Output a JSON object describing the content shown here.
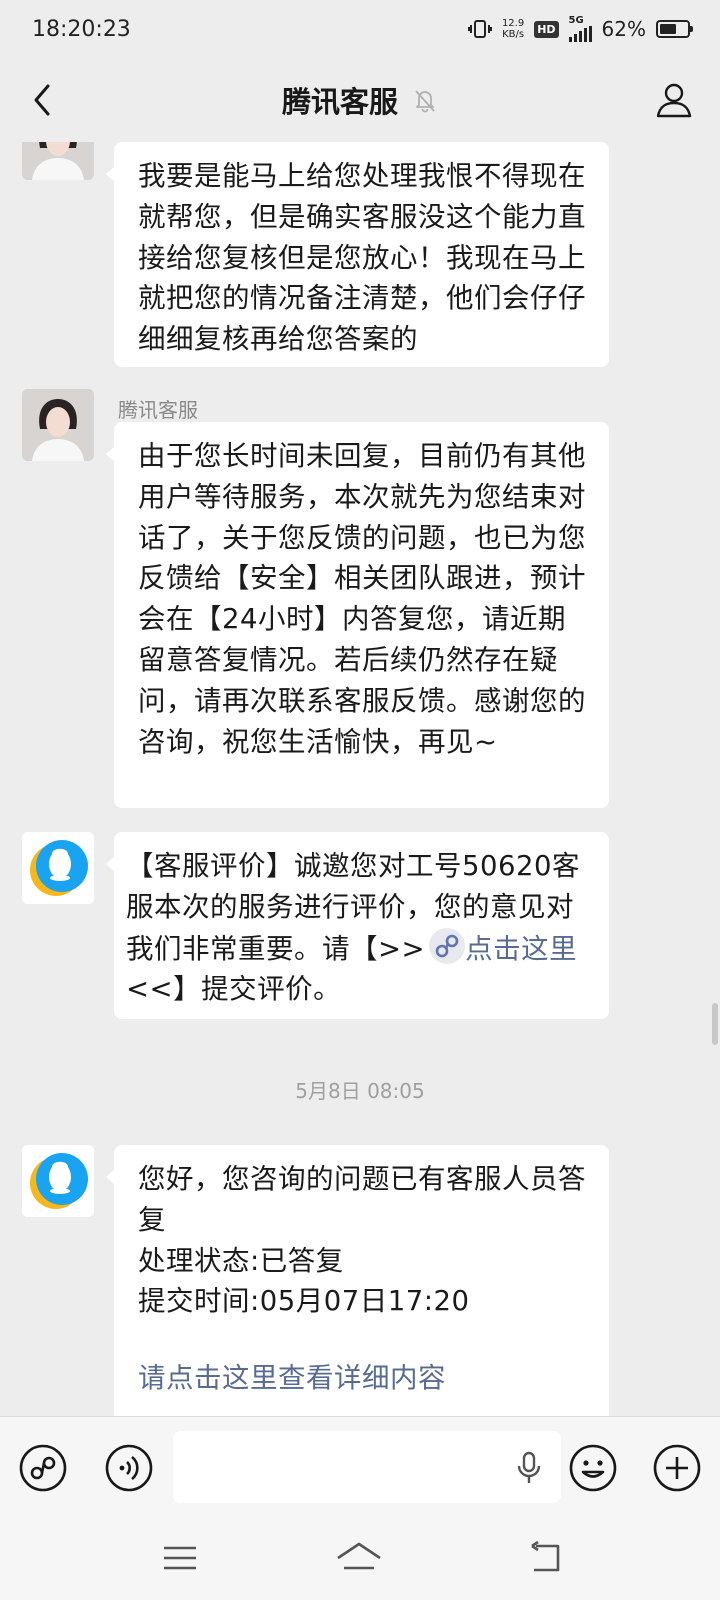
{
  "status_bar": {
    "time": "18:20:23",
    "net_speed_value": "12.9",
    "net_speed_unit": "KB/s",
    "hd_label": "HD",
    "network_type": "5G",
    "battery_percent": "62%",
    "battery_level": 0.62
  },
  "header": {
    "title": "腾讯客服",
    "back_icon": "chevron-left-icon",
    "mute_icon": "bell-off-icon",
    "profile_icon": "person-icon"
  },
  "messages": [
    {
      "sender": "",
      "avatar": "agent-photo",
      "text": "我要是能马上给您处理我恨不得现在就帮您，但是确实客服没这个能力直接给您复核但是您放心！我现在马上就把您的情况备注清楚，他们会仔仔细细复核再给您答案的"
    },
    {
      "sender": "腾讯客服",
      "avatar": "agent-photo",
      "text": "由于您长时间未回复，目前仍有其他用户等待服务，本次就先为您结束对话了，关于您反馈的问题，也已为您反馈给【安全】相关团队跟进，预计会在【24小时】内答复您，请近期留意答复情况。若后续仍然存在疑问，请再次联系客服反馈。感谢您的咨询，祝您生活愉快，再见~"
    },
    {
      "sender": "",
      "avatar": "qq-service-logo",
      "text_before": "【客服评价】诚邀您对工号50620客服本次的服务进行评价，您的意见对我们非常重要。请【>>",
      "link_text": "点击这里",
      "text_after": "<<】提交评价。"
    },
    {
      "timestamp": "5月8日 08:05"
    },
    {
      "sender": "",
      "avatar": "qq-service-logo",
      "lines": [
        "您好，您咨询的问题已有客服人员答复",
        "处理状态:已答复",
        "提交时间:05月07日17:20"
      ],
      "link_text": "请点击这里查看详细内容"
    }
  ],
  "input_bar": {
    "placeholder": "",
    "left_icons": [
      "mini-program-icon",
      "voice-icon"
    ],
    "right_icons": [
      "emoji-icon",
      "plus-icon"
    ],
    "mic_icon": "microphone-icon"
  },
  "nav_bar": {
    "icons": [
      "menu-icon",
      "home-icon",
      "back-icon"
    ]
  },
  "colors": {
    "background": "#ededed",
    "bubble": "#ffffff",
    "link": "#576b95"
  }
}
